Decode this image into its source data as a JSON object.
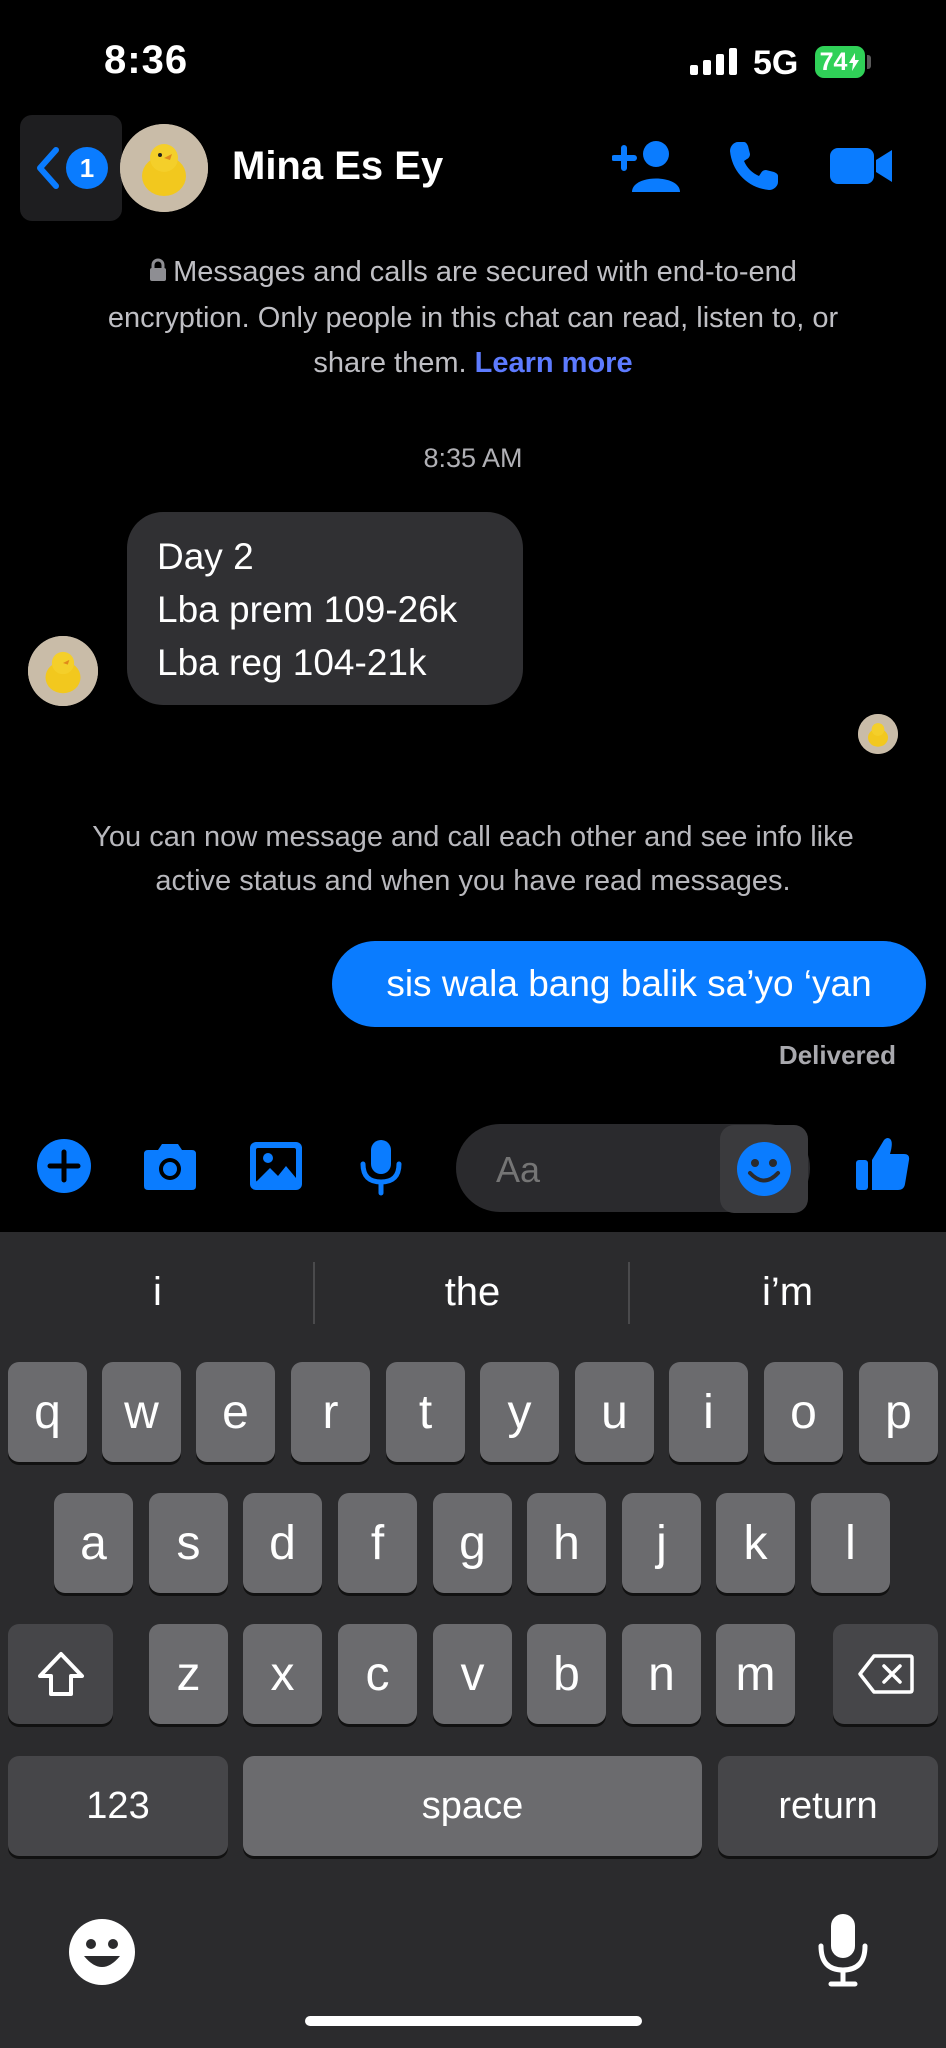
{
  "status_bar": {
    "time": "8:36",
    "network": "5G",
    "battery": "74"
  },
  "header": {
    "back_badge": "1",
    "contact_name": "Mina Es Ey"
  },
  "encryption_notice": {
    "line1": "Messages and calls are secured with end-to-end",
    "line2": "encryption. Only people in this chat can read, listen to, or",
    "line3": "share them.",
    "link": "Learn more"
  },
  "timestamp": "8:35 AM",
  "incoming_message": {
    "lines": [
      "Day 2",
      "Lba prem 109-26k",
      "Lba reg 104-21k"
    ]
  },
  "info_notice": {
    "line1": "You can now message and call each other and see info like",
    "line2": "active status and when you have read messages."
  },
  "outgoing_message": {
    "text": "sis wala bang balik sa’yo ‘yan",
    "status": "Delivered"
  },
  "composer": {
    "placeholder": "Aa"
  },
  "keyboard": {
    "suggestions": [
      "i",
      "the",
      "i’m"
    ],
    "row1": [
      "q",
      "w",
      "e",
      "r",
      "t",
      "y",
      "u",
      "i",
      "o",
      "p"
    ],
    "row2": [
      "a",
      "s",
      "d",
      "f",
      "g",
      "h",
      "j",
      "k",
      "l"
    ],
    "row3": [
      "z",
      "x",
      "c",
      "v",
      "b",
      "n",
      "m"
    ],
    "numbers_key": "123",
    "space_key": "space",
    "return_key": "return"
  },
  "colors": {
    "accent": "#0a7cff",
    "link": "#5d7bff",
    "battery": "#30d158",
    "keyboard_bg": "#2b2b2d",
    "key": "#6b6b6e"
  },
  "icons": [
    "back-chevron-icon",
    "add-person-icon",
    "phone-icon",
    "video-camera-icon",
    "plus-circle-icon",
    "camera-icon",
    "photo-icon",
    "microphone-icon",
    "emoji-icon",
    "thumbs-up-icon",
    "shift-icon",
    "backspace-icon",
    "keyboard-emoji-icon",
    "dictation-icon",
    "lock-icon"
  ]
}
